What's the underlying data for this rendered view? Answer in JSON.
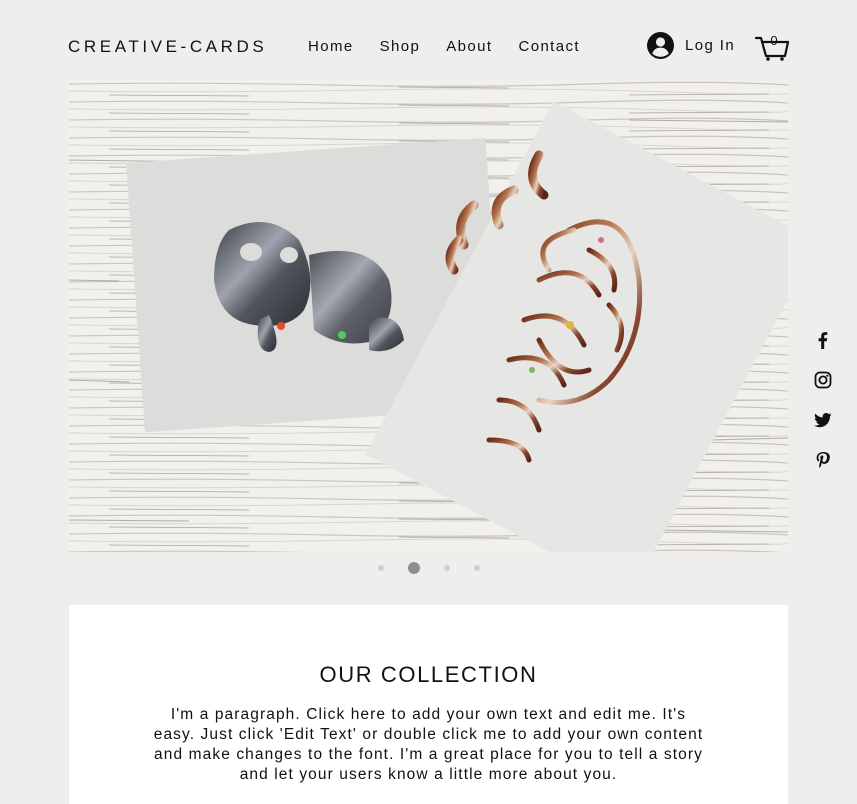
{
  "header": {
    "logo": "CREATIVE-CARDS",
    "nav": [
      "Home",
      "Shop",
      "About",
      "Contact"
    ],
    "login_label": "Log In",
    "cart_count": "0"
  },
  "slideshow": {
    "slide_count": 4,
    "active_index": 1
  },
  "social": {
    "icons": [
      "facebook-icon",
      "instagram-icon",
      "twitter-icon",
      "pinterest-icon"
    ]
  },
  "collection": {
    "title": "OUR COLLECTION",
    "paragraph": "I'm a paragraph. Click here to add your own text and edit me. It's easy. Just click 'Edit Text' or double click me to add your own content and make changes to the font. I'm a great place for you to tell a story and let your users know a little more about you."
  },
  "colors": {
    "page_bg": "#efeeec",
    "section_bg": "#ffffff",
    "dot_active": "#8f8f8f",
    "dot_inactive": "#cfcfcf"
  }
}
